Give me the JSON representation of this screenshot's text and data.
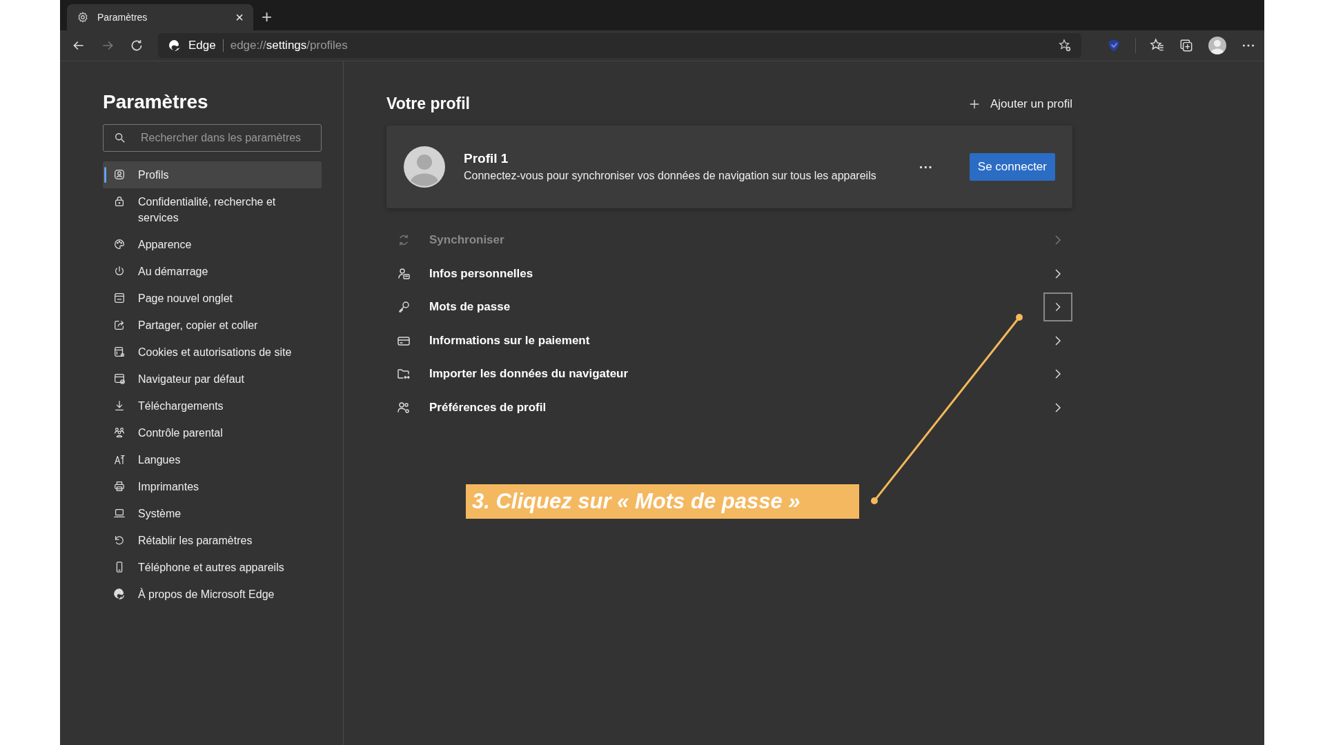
{
  "tab": {
    "title": "Paramètres",
    "close": "×",
    "new_tab": "+"
  },
  "address_bar": {
    "site": "Edge",
    "url_prefix": "edge://",
    "url_main": "settings",
    "url_suffix": "/profiles"
  },
  "sidebar": {
    "title": "Paramètres",
    "search": {
      "placeholder": "Rechercher dans les paramètres"
    },
    "items": [
      {
        "label": "Profils",
        "selected": true
      },
      {
        "label": "Confidentialité, recherche et services",
        "selected": false
      },
      {
        "label": "Apparence",
        "selected": false
      },
      {
        "label": "Au démarrage",
        "selected": false
      },
      {
        "label": "Page nouvel onglet",
        "selected": false
      },
      {
        "label": "Partager, copier et coller",
        "selected": false
      },
      {
        "label": "Cookies et autorisations de site",
        "selected": false
      },
      {
        "label": "Navigateur par défaut",
        "selected": false
      },
      {
        "label": "Téléchargements",
        "selected": false
      },
      {
        "label": "Contrôle parental",
        "selected": false
      },
      {
        "label": "Langues",
        "selected": false
      },
      {
        "label": "Imprimantes",
        "selected": false
      },
      {
        "label": "Système",
        "selected": false
      },
      {
        "label": "Rétablir les paramètres",
        "selected": false
      },
      {
        "label": "Téléphone et autres appareils",
        "selected": false
      },
      {
        "label": "À propos de Microsoft Edge",
        "selected": false
      }
    ]
  },
  "main": {
    "title": "Votre profil",
    "add_profile": "Ajouter un profil",
    "profile_card": {
      "name": "Profil 1",
      "description": "Connectez-vous pour synchroniser vos données de navigation sur tous les appareils",
      "more": "···",
      "sign_in": "Se connecter"
    },
    "rows": [
      {
        "label": "Synchroniser",
        "disabled": true,
        "highlighted": false
      },
      {
        "label": "Infos personnelles",
        "disabled": false,
        "highlighted": false
      },
      {
        "label": "Mots de passe",
        "disabled": false,
        "highlighted": true
      },
      {
        "label": "Informations sur le paiement",
        "disabled": false,
        "highlighted": false
      },
      {
        "label": "Importer les données du navigateur",
        "disabled": false,
        "highlighted": false
      },
      {
        "label": "Préférences de profil",
        "disabled": false,
        "highlighted": false
      }
    ]
  },
  "annotation": {
    "text": "3. Cliquez sur « Mots de passe »"
  }
}
